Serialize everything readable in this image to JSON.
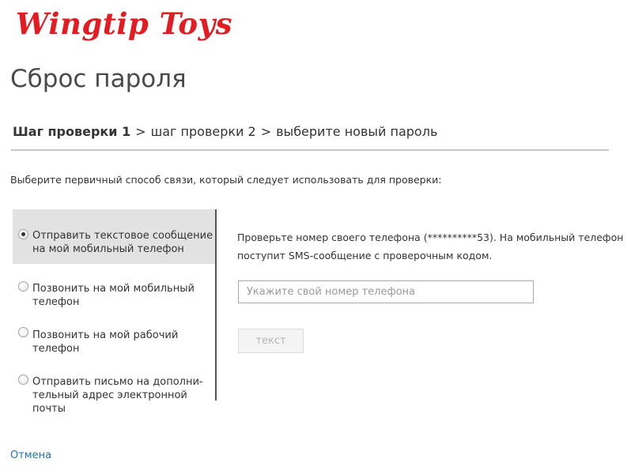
{
  "logo": {
    "text": "Wingtip Toys"
  },
  "page_title": "Сброс пароля",
  "breadcrumb": {
    "step1": "Шаг проверки 1",
    "step2": "шаг проверки 2",
    "step3": "выберите новый пароль",
    "separator": ">"
  },
  "instruction": "Выберите первичный способ связи, который следует использовать для проверки:",
  "options": [
    {
      "line1": "Отправить текстовое сообщение",
      "line2": "на мой мобильный телефон",
      "selected": true
    },
    {
      "line1": "Позвонить на мой мобильный",
      "line2": "телефон",
      "selected": false
    },
    {
      "line1": "Позвонить на мой рабочий",
      "line2": "телефон",
      "selected": false
    },
    {
      "line1": "Отправить письмо на дополни-",
      "line2": "тельный адрес электронной почты",
      "selected": false
    }
  ],
  "message": {
    "line1": "Проверьте номер своего телефона (**********53). На мобильный телефон",
    "line2": "поступит SMS-сообщение с проверочным кодом."
  },
  "phone_input": {
    "value": "",
    "placeholder": "Укажите свой номер телефона"
  },
  "text_button": {
    "label": "текст",
    "disabled": true
  },
  "cancel_link": "Отмена",
  "colors": {
    "brand": "#e31b23",
    "link": "#2672a5",
    "selected_option_bg": "#e2e2e2",
    "divider": "#c6c6c6"
  },
  "icons": [
    "radio-checked",
    "radio-unchecked"
  ]
}
